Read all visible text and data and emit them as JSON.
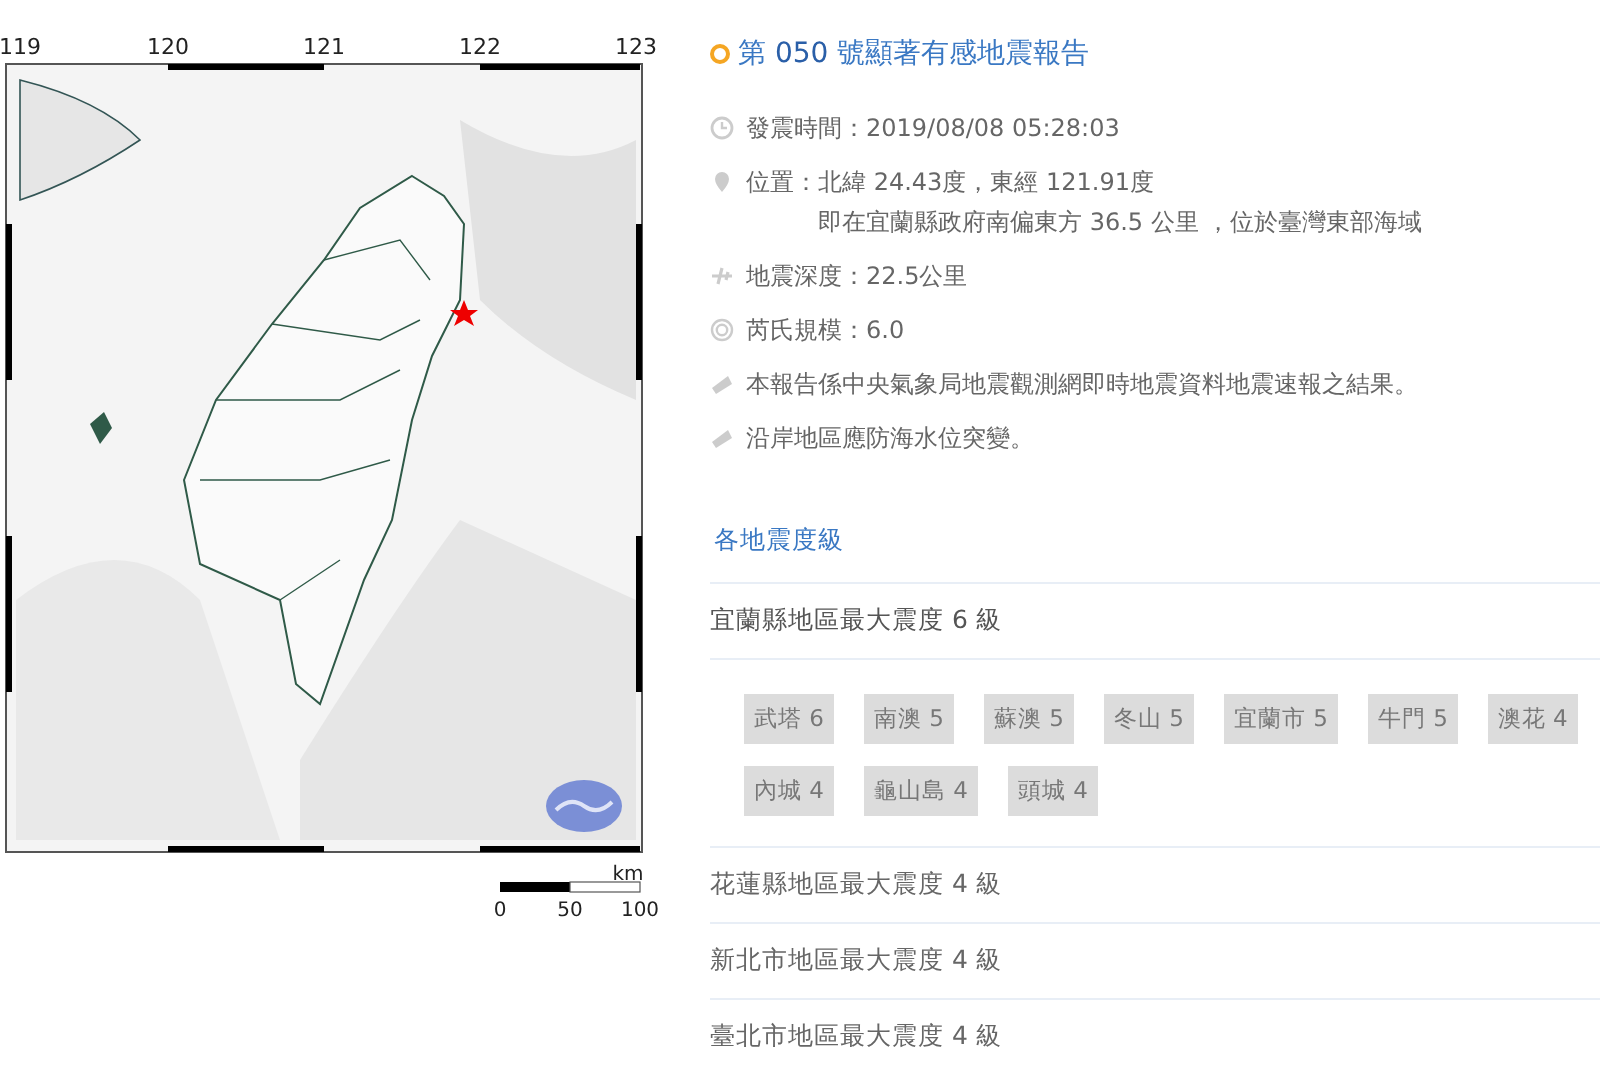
{
  "map": {
    "longitude_labels": [
      "119",
      "120",
      "121",
      "122",
      "123"
    ],
    "scale_unit": "km",
    "scale_labels": [
      "0",
      "50",
      "100"
    ]
  },
  "report": {
    "title_prefix": "第",
    "number": "050",
    "title_suffix": "號顯著有感地震報告",
    "details": [
      {
        "kind": "time",
        "text": "發震時間：2019/08/08 05:28:03"
      },
      {
        "kind": "location",
        "text": "位置：北緯 24.43度，東經 121.91度",
        "subtext": "即在宜蘭縣政府南偏東方 36.5 公里 ，位於臺灣東部海域"
      },
      {
        "kind": "depth",
        "text": "地震深度：22.5公里"
      },
      {
        "kind": "magnitude",
        "text": "芮氏規模：6.0"
      },
      {
        "kind": "notice",
        "text": "本報告係中央氣象局地震觀測網即時地震資料地震速報之結果。"
      },
      {
        "kind": "notice",
        "text": "沿岸地區應防海水位突變。"
      }
    ]
  },
  "intensity": {
    "heading": "各地震度級",
    "regions": [
      {
        "title": "宜蘭縣地區最大震度 6 級",
        "expanded": true,
        "stations": [
          "武塔 6",
          "南澳 5",
          "蘇澳 5",
          "冬山 5",
          "宜蘭市 5",
          "牛門 5",
          "澳花 4",
          "內城 4",
          "龜山島 4",
          "頭城 4"
        ]
      },
      {
        "title": "花蓮縣地區最大震度 4 級",
        "expanded": false
      },
      {
        "title": "新北市地區最大震度 4 級",
        "expanded": false
      },
      {
        "title": "臺北市地區最大震度 4 級",
        "expanded": false
      }
    ]
  }
}
